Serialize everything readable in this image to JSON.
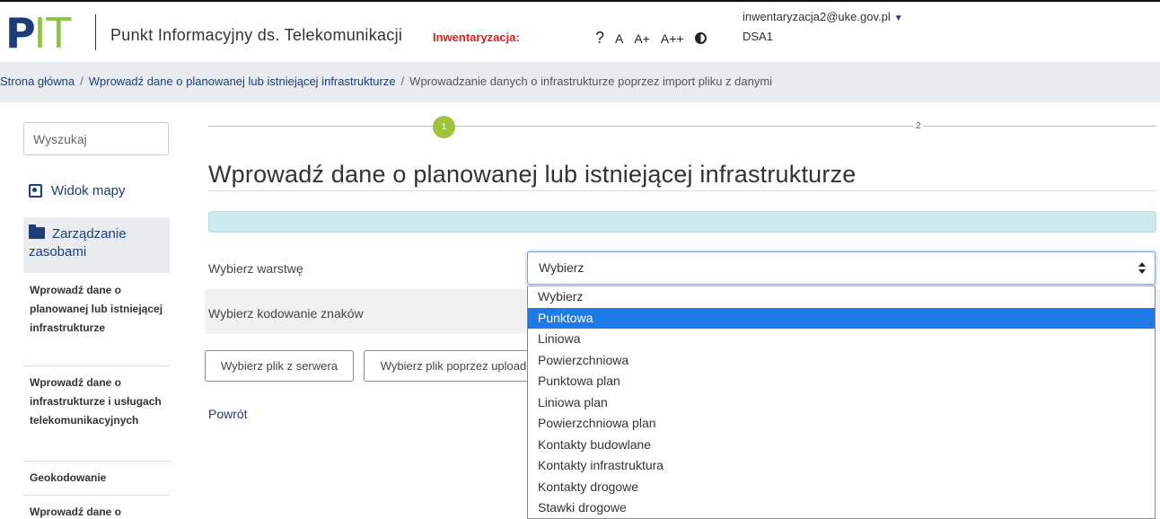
{
  "header": {
    "logo_p": "P",
    "logo_it": "IT",
    "title": "Punkt Informacyjny ds. Telekomunikacji",
    "badge": "Inwentaryzacja:",
    "help": "?",
    "font_a": "A",
    "font_a_plus": "A+",
    "font_a_plusplus": "A++",
    "user_email": "inwentaryzacja2@uke.gov.pl",
    "user_org": "DSA1"
  },
  "breadcrumb": {
    "home": "Strona główna",
    "sep1": "/",
    "level2": "Wprowadź dane o planowanej lub istniejącej infrastrukturze",
    "sep2": "/",
    "current": "Wprowadzanie danych o infrastrukturze poprzez import pliku z danymi"
  },
  "sidebar": {
    "search_placeholder": "Wyszukaj",
    "map_view": "Widok mapy",
    "resources": "Zarządzanie zasobami",
    "items": [
      "Wprowadź dane o planowanej lub istniejącej infrastrukturze",
      "Wprowadź dane o infrastrukturze i usługach telekomunikacyjnych",
      "Geokodowanie",
      "Wprowadź dane o"
    ]
  },
  "stepper": {
    "step1": "1",
    "step2": "2"
  },
  "main": {
    "title": "Wprowadź dane o planowanej lub istniejącej infrastrukturze",
    "layer_label": "Wybierz warstwę",
    "encoding_label": "Wybierz kodowanie znaków",
    "layer_select_value": "Wybierz",
    "btn_server": "Wybierz plik z serwera",
    "btn_upload": "Wybierz plik poprzez upload",
    "back": "Powrót"
  },
  "dropdown": {
    "options": [
      "Wybierz",
      "Punktowa",
      "Liniowa",
      "Powierzchniowa",
      "Punktowa plan",
      "Liniowa plan",
      "Powierzchniowa plan",
      "Kontakty budowlane",
      "Kontakty infrastruktura",
      "Kontakty drogowe",
      "Stawki drogowe"
    ],
    "highlighted": "Punktowa"
  },
  "colors": {
    "brand_navy": "#1e3c78",
    "brand_green": "#8cc63f",
    "badge_red": "#dc1c1c",
    "step_active": "#9dc43c",
    "option_highlight": "#1e7ae6",
    "alert_bg": "#cdeaee"
  },
  "icons": {
    "map_view": "map-icon",
    "resources": "folder-icon",
    "contrast": "contrast-icon",
    "user_menu": "caret-down-icon",
    "select": "select-arrows-icon"
  }
}
